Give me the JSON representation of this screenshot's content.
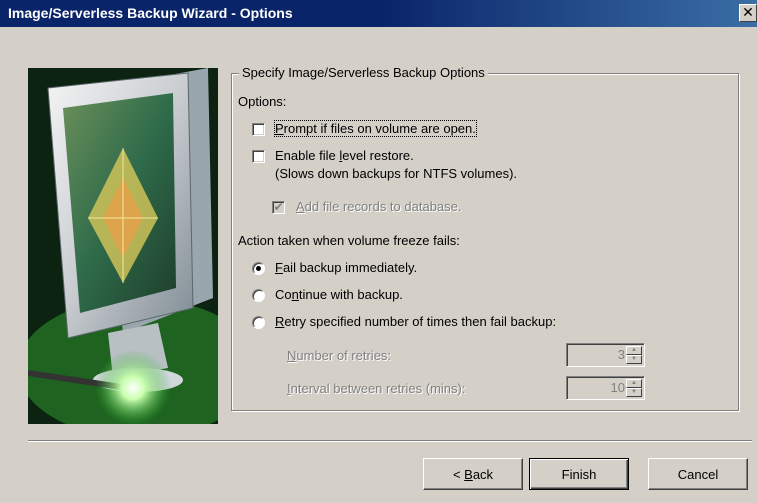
{
  "window": {
    "title": "Image/Serverless Backup Wizard - Options",
    "close_glyph": "✕"
  },
  "group": {
    "legend": "Specify Image/Serverless Backup Options",
    "options_label": "Options:",
    "prompt_open_files": {
      "label_pre": "",
      "accel": "P",
      "label_post": "rompt if files on volume are open.",
      "checked": false
    },
    "file_level_restore": {
      "label_pre": "Enable file ",
      "accel": "l",
      "label_post": "evel restore.",
      "sub": "(Slows down backups for NTFS volumes).",
      "checked": false
    },
    "add_file_records": {
      "label_pre": "",
      "accel": "A",
      "label_post": "dd file records to database.",
      "checked": true,
      "check_glyph": "✔"
    },
    "freeze_label": "Action taken when volume freeze fails:",
    "radio_fail": {
      "label_pre": "",
      "accel": "F",
      "label_post": "ail backup immediately.",
      "selected": true
    },
    "radio_continue": {
      "label_pre": "Co",
      "accel": "n",
      "label_post": "tinue with backup.",
      "selected": false
    },
    "radio_retry": {
      "label_pre": "",
      "accel": "R",
      "label_post": "etry specified number of times then fail backup:",
      "selected": false
    },
    "retries": {
      "label_pre": "",
      "accel": "N",
      "label_post": "umber of retries:",
      "value": "3"
    },
    "interval": {
      "label_pre": "",
      "accel": "I",
      "label_post": "nterval between retries (mins):",
      "value": "10"
    },
    "spin_up_glyph": "▲",
    "spin_down_glyph": "▼"
  },
  "buttons": {
    "back": {
      "label_pre": "< ",
      "accel": "B",
      "label_post": "ack"
    },
    "finish": "Finish",
    "cancel": "Cancel"
  },
  "colors": {
    "titlebar": "#0a246a",
    "face": "#d4d0c8",
    "disabled_text": "#808080"
  }
}
